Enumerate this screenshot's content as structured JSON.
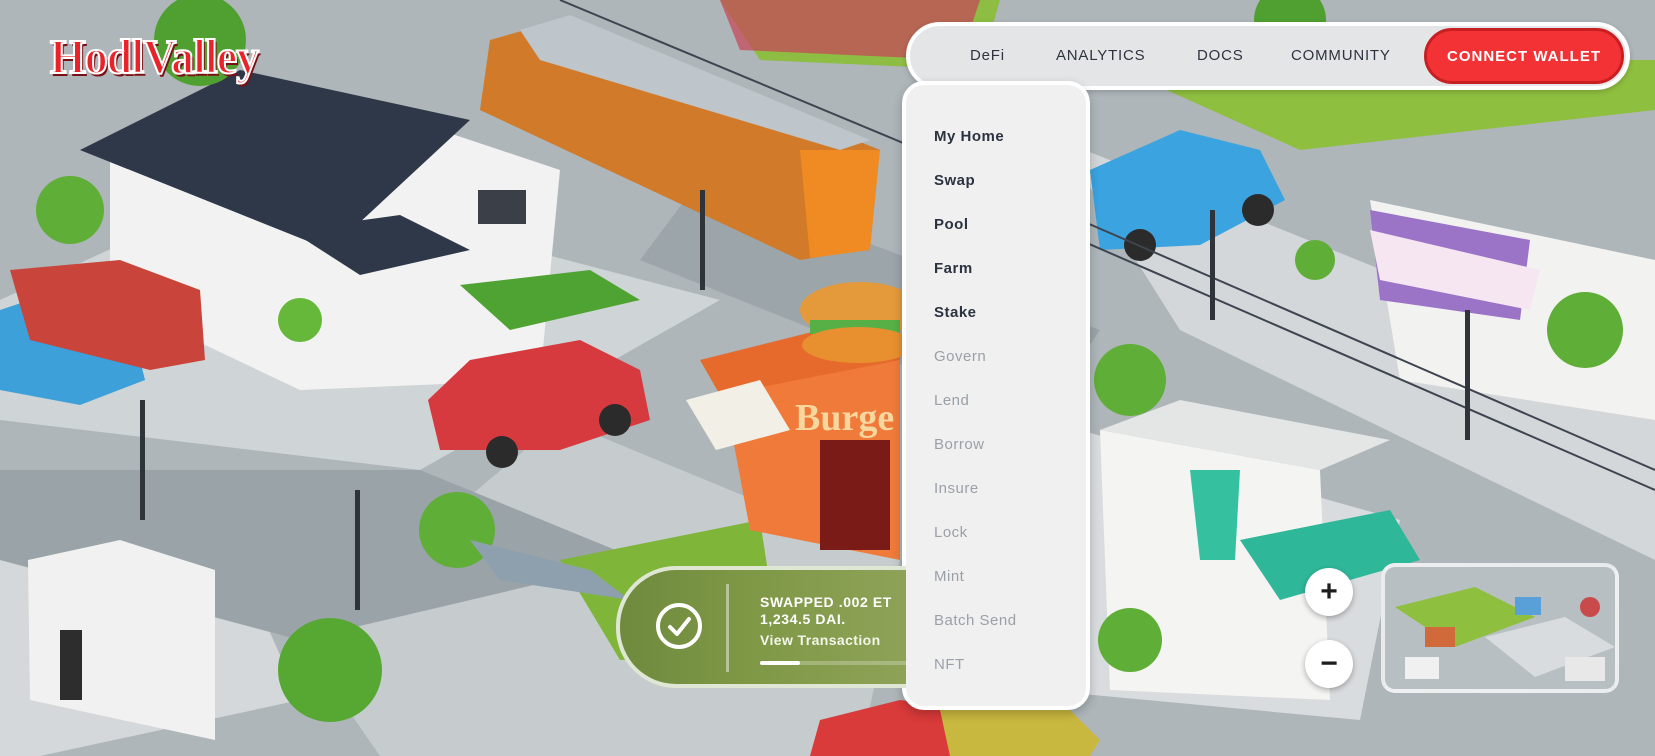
{
  "brand": {
    "logo_text": "HodlValley"
  },
  "nav": {
    "items": [
      {
        "label": "DeFi"
      },
      {
        "label": "ANALYTICS"
      },
      {
        "label": "DOCS"
      },
      {
        "label": "COMMUNITY"
      }
    ],
    "connect_label": "CONNECT WALLET"
  },
  "defi_menu": {
    "items": [
      {
        "label": "My Home",
        "enabled": true
      },
      {
        "label": "Swap",
        "enabled": true
      },
      {
        "label": "Pool",
        "enabled": true
      },
      {
        "label": "Farm",
        "enabled": true
      },
      {
        "label": "Stake",
        "enabled": true
      },
      {
        "label": "Govern",
        "enabled": false
      },
      {
        "label": "Lend",
        "enabled": false
      },
      {
        "label": "Borrow",
        "enabled": false
      },
      {
        "label": "Insure",
        "enabled": false
      },
      {
        "label": "Lock",
        "enabled": false
      },
      {
        "label": "Mint",
        "enabled": false
      },
      {
        "label": "Batch Send",
        "enabled": false
      },
      {
        "label": "NFT",
        "enabled": false
      }
    ]
  },
  "toast": {
    "line1": "SWAPPED .002 ET",
    "line2": "1,234.5 DAI.",
    "link": "View Transaction",
    "progress_fraction": 0.25
  },
  "map_controls": {
    "zoom_in_symbol": "+",
    "zoom_out_symbol": "−",
    "icons": [
      "check-icon",
      "plus-icon",
      "minus-icon"
    ]
  },
  "scene_sign": "Burge",
  "colors": {
    "brand_red": "#e8232a",
    "connect_bg": "#f23234",
    "toast_green": "#7e9846",
    "menu_active": "#2b3340",
    "menu_disabled": "#9aa0a8"
  }
}
